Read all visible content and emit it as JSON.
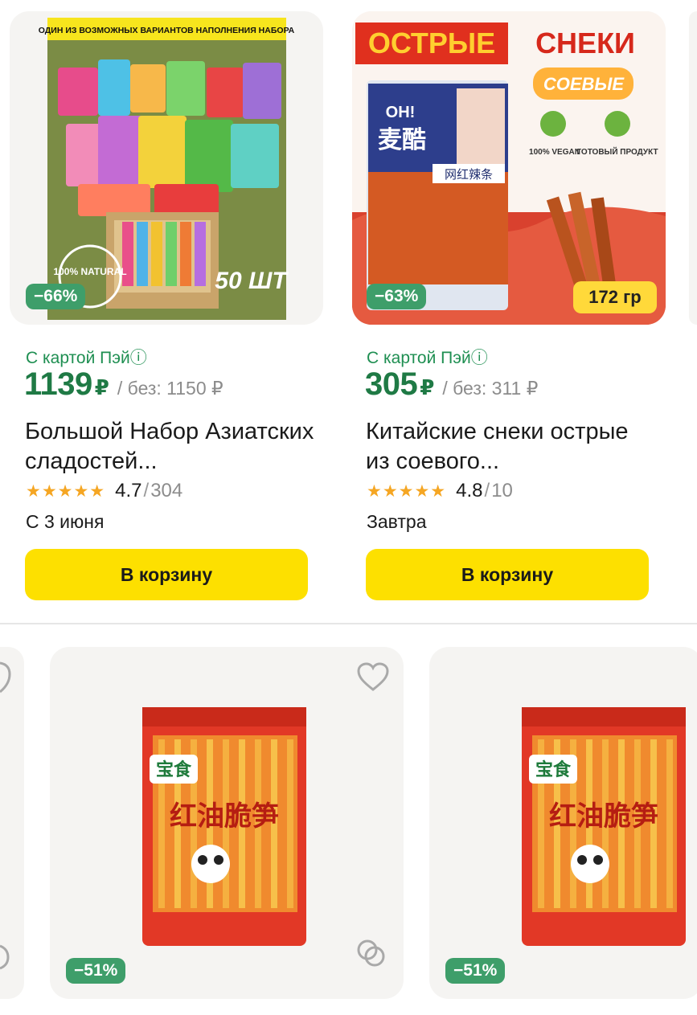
{
  "products_top": [
    {
      "image_banner": "ОДИН ИЗ ВОЗМОЖНЫХ ВАРИАНТОВ НАПОЛНЕНИЯ НАБОРА",
      "image_natural": "100% NATURAL",
      "image_count": "50 ШТ",
      "discount": "−66%",
      "promo": "С картой Пэйⓘ",
      "price": "1139",
      "currency": "₽",
      "old_price": "/ без: 1150 ₽",
      "title": "Большой Набор Азиатских сладостей...",
      "rating": "4.7",
      "separator": "/",
      "reviews": "304",
      "delivery": "С 3 июня",
      "cart_label": "В корзину"
    },
    {
      "image_headline_1": "ОСТРЫЕ",
      "image_headline_2": "СНЕКИ",
      "image_sub": "СОЕВЫЕ",
      "image_vegan": "100% VEGAN",
      "image_ready": "ГОТОВЫЙ ПРОДУКТ",
      "image_weight": "172 гр",
      "image_pack_oh": "OH!",
      "image_pack_cn": "麦酷",
      "image_pack_sub": "网红辣条",
      "discount": "−63%",
      "promo": "С картой Пэйⓘ",
      "price": "305",
      "currency": "₽",
      "old_price": "/ без: 311 ₽",
      "title": "Китайские снеки острые из соевого...",
      "rating": "4.8",
      "separator": "/",
      "reviews": "10",
      "delivery": "Завтра",
      "cart_label": "В корзину"
    }
  ],
  "products_bottom": [
    {
      "discount": "−51%",
      "pack_brand": "宝食",
      "pack_title": "红油脆笋"
    },
    {
      "discount": "−51%",
      "pack_brand": "宝食",
      "pack_title": "红油脆笋"
    }
  ],
  "colors": {
    "accent_green": "#1f7a45",
    "badge_green": "#3e9e6a",
    "button_yellow": "#fde000"
  },
  "icons": [
    "heart-icon",
    "compare-icon",
    "star-icon"
  ]
}
